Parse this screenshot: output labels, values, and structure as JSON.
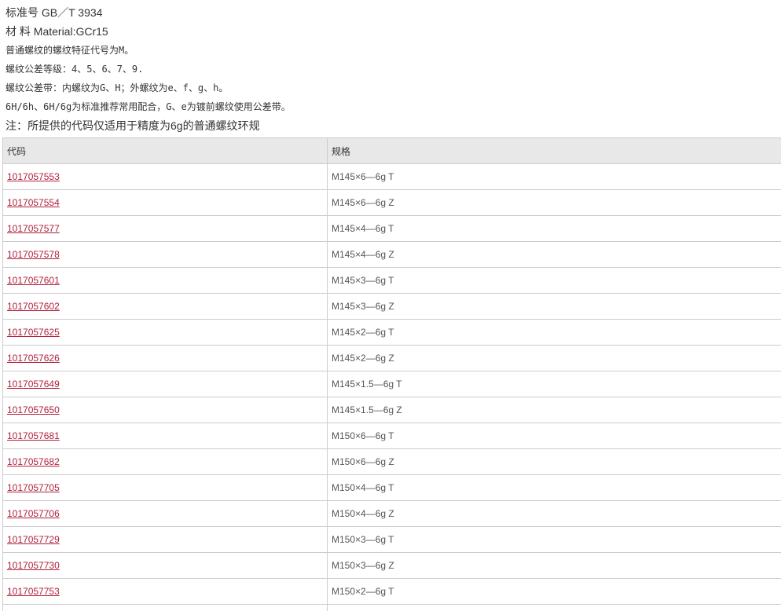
{
  "info": [
    "标准号 GB／T 3934",
    "材 料 Material:GCr15",
    "普通螺纹的螺纹特征代号为M。",
    "螺纹公差等级：4、5、6、7、9.",
    "螺纹公差带：内螺纹为G、H；外螺纹为e、f、g、h。",
    "6H/6h、6H/6g为标准推荐常用配合，G、e为镀前螺纹使用公差带。",
    " 注：所提供的代码仅适用于精度为6g的普通螺纹环规"
  ],
  "table": {
    "headers": [
      "代码",
      "规格"
    ],
    "rows": [
      {
        "code": "1017057553",
        "spec": "M145×6—6g T"
      },
      {
        "code": "1017057554",
        "spec": "M145×6—6g Z"
      },
      {
        "code": "1017057577",
        "spec": "M145×4—6g T"
      },
      {
        "code": "1017057578",
        "spec": "M145×4—6g Z"
      },
      {
        "code": "1017057601",
        "spec": "M145×3—6g T"
      },
      {
        "code": "1017057602",
        "spec": "M145×3—6g Z"
      },
      {
        "code": "1017057625",
        "spec": "M145×2—6g T"
      },
      {
        "code": "1017057626",
        "spec": "M145×2—6g Z"
      },
      {
        "code": "1017057649",
        "spec": "M145×1.5—6g T"
      },
      {
        "code": "1017057650",
        "spec": "M145×1.5—6g Z"
      },
      {
        "code": "1017057681",
        "spec": "M150×6—6g T"
      },
      {
        "code": "1017057682",
        "spec": "M150×6—6g Z"
      },
      {
        "code": "1017057705",
        "spec": "M150×4—6g T"
      },
      {
        "code": "1017057706",
        "spec": "M150×4—6g Z"
      },
      {
        "code": "1017057729",
        "spec": "M150×3—6g T"
      },
      {
        "code": "1017057730",
        "spec": "M150×3—6g Z"
      },
      {
        "code": "1017057753",
        "spec": "M150×2—6g T"
      },
      {
        "code": "",
        "spec": ""
      }
    ]
  },
  "colors": {
    "link": "#b0203c",
    "header_bg": "#e8e8e8",
    "border": "#cccccc"
  }
}
